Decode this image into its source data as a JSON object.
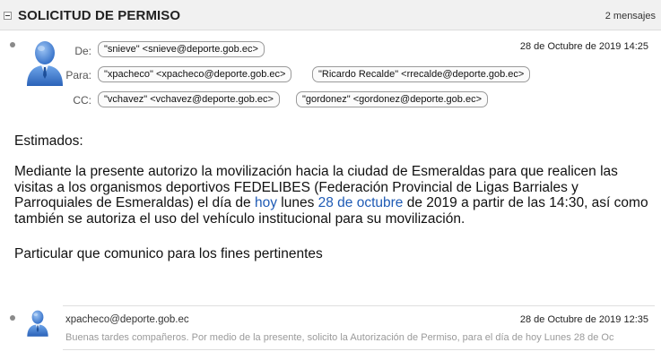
{
  "thread": {
    "title": "SOLICITUD DE PERMISO",
    "count": "2 mensajes"
  },
  "message1": {
    "labels": {
      "from": "De:",
      "to": "Para:",
      "cc": "CC:"
    },
    "from": "\"snieve\" <snieve@deporte.gob.ec>",
    "to": [
      "\"xpacheco\" <xpacheco@deporte.gob.ec>",
      "\"Ricardo Recalde\" <rrecalde@deporte.gob.ec>"
    ],
    "cc": [
      "\"vchavez\" <vchavez@deporte.gob.ec>",
      "\"gordonez\" <gordonez@deporte.gob.ec>"
    ],
    "date": "28 de Octubre de 2019 14:25",
    "body": {
      "greeting": "Estimados:",
      "p1_a": "Mediante la presente autorizo la movilización hacia la ciudad de Esmeraldas para que  realicen las visitas a los organismos deportivos FEDELIBES (Federación Provincial de Ligas Barriales y Parroquiales de Esmeraldas) el día de ",
      "p1_hl1": "hoy",
      "p1_b": " lunes ",
      "p1_hl2": "28 de octubre",
      "p1_c": " de  2019 a partir de las 14:30, así como también se autoriza el uso del vehículo institucional para su movilización.",
      "closing": "Particular que comunico para los fines pertinentes"
    }
  },
  "message2": {
    "sender": "xpacheco@deporte.gob.ec",
    "date": "28 de Octubre de 2019 12:35",
    "preview": "Buenas tardes compañeros. Por medio de la presente, solicito la Autorización de Permiso, para el día de hoy Lunes 28 de Oc"
  },
  "icons": {
    "avatar": "user-avatar-icon",
    "collapse": "collapse-icon",
    "bullet": "unread-dot-icon"
  },
  "colors": {
    "link_highlight": "#1f5bb5",
    "avatar_blue": "#3b7bd4",
    "header_bg": "#f1f1f1"
  }
}
